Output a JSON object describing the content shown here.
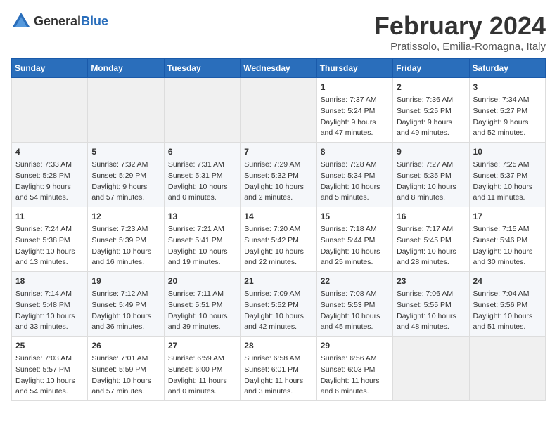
{
  "logo": {
    "text_general": "General",
    "text_blue": "Blue"
  },
  "calendar": {
    "title": "February 2024",
    "subtitle": "Pratissolo, Emilia-Romagna, Italy",
    "days_header": [
      "Sunday",
      "Monday",
      "Tuesday",
      "Wednesday",
      "Thursday",
      "Friday",
      "Saturday"
    ],
    "weeks": [
      [
        {
          "day": "",
          "content": ""
        },
        {
          "day": "",
          "content": ""
        },
        {
          "day": "",
          "content": ""
        },
        {
          "day": "",
          "content": ""
        },
        {
          "day": "1",
          "content": "Sunrise: 7:37 AM\nSunset: 5:24 PM\nDaylight: 9 hours\nand 47 minutes."
        },
        {
          "day": "2",
          "content": "Sunrise: 7:36 AM\nSunset: 5:25 PM\nDaylight: 9 hours\nand 49 minutes."
        },
        {
          "day": "3",
          "content": "Sunrise: 7:34 AM\nSunset: 5:27 PM\nDaylight: 9 hours\nand 52 minutes."
        }
      ],
      [
        {
          "day": "4",
          "content": "Sunrise: 7:33 AM\nSunset: 5:28 PM\nDaylight: 9 hours\nand 54 minutes."
        },
        {
          "day": "5",
          "content": "Sunrise: 7:32 AM\nSunset: 5:29 PM\nDaylight: 9 hours\nand 57 minutes."
        },
        {
          "day": "6",
          "content": "Sunrise: 7:31 AM\nSunset: 5:31 PM\nDaylight: 10 hours\nand 0 minutes."
        },
        {
          "day": "7",
          "content": "Sunrise: 7:29 AM\nSunset: 5:32 PM\nDaylight: 10 hours\nand 2 minutes."
        },
        {
          "day": "8",
          "content": "Sunrise: 7:28 AM\nSunset: 5:34 PM\nDaylight: 10 hours\nand 5 minutes."
        },
        {
          "day": "9",
          "content": "Sunrise: 7:27 AM\nSunset: 5:35 PM\nDaylight: 10 hours\nand 8 minutes."
        },
        {
          "day": "10",
          "content": "Sunrise: 7:25 AM\nSunset: 5:37 PM\nDaylight: 10 hours\nand 11 minutes."
        }
      ],
      [
        {
          "day": "11",
          "content": "Sunrise: 7:24 AM\nSunset: 5:38 PM\nDaylight: 10 hours\nand 13 minutes."
        },
        {
          "day": "12",
          "content": "Sunrise: 7:23 AM\nSunset: 5:39 PM\nDaylight: 10 hours\nand 16 minutes."
        },
        {
          "day": "13",
          "content": "Sunrise: 7:21 AM\nSunset: 5:41 PM\nDaylight: 10 hours\nand 19 minutes."
        },
        {
          "day": "14",
          "content": "Sunrise: 7:20 AM\nSunset: 5:42 PM\nDaylight: 10 hours\nand 22 minutes."
        },
        {
          "day": "15",
          "content": "Sunrise: 7:18 AM\nSunset: 5:44 PM\nDaylight: 10 hours\nand 25 minutes."
        },
        {
          "day": "16",
          "content": "Sunrise: 7:17 AM\nSunset: 5:45 PM\nDaylight: 10 hours\nand 28 minutes."
        },
        {
          "day": "17",
          "content": "Sunrise: 7:15 AM\nSunset: 5:46 PM\nDaylight: 10 hours\nand 30 minutes."
        }
      ],
      [
        {
          "day": "18",
          "content": "Sunrise: 7:14 AM\nSunset: 5:48 PM\nDaylight: 10 hours\nand 33 minutes."
        },
        {
          "day": "19",
          "content": "Sunrise: 7:12 AM\nSunset: 5:49 PM\nDaylight: 10 hours\nand 36 minutes."
        },
        {
          "day": "20",
          "content": "Sunrise: 7:11 AM\nSunset: 5:51 PM\nDaylight: 10 hours\nand 39 minutes."
        },
        {
          "day": "21",
          "content": "Sunrise: 7:09 AM\nSunset: 5:52 PM\nDaylight: 10 hours\nand 42 minutes."
        },
        {
          "day": "22",
          "content": "Sunrise: 7:08 AM\nSunset: 5:53 PM\nDaylight: 10 hours\nand 45 minutes."
        },
        {
          "day": "23",
          "content": "Sunrise: 7:06 AM\nSunset: 5:55 PM\nDaylight: 10 hours\nand 48 minutes."
        },
        {
          "day": "24",
          "content": "Sunrise: 7:04 AM\nSunset: 5:56 PM\nDaylight: 10 hours\nand 51 minutes."
        }
      ],
      [
        {
          "day": "25",
          "content": "Sunrise: 7:03 AM\nSunset: 5:57 PM\nDaylight: 10 hours\nand 54 minutes."
        },
        {
          "day": "26",
          "content": "Sunrise: 7:01 AM\nSunset: 5:59 PM\nDaylight: 10 hours\nand 57 minutes."
        },
        {
          "day": "27",
          "content": "Sunrise: 6:59 AM\nSunset: 6:00 PM\nDaylight: 11 hours\nand 0 minutes."
        },
        {
          "day": "28",
          "content": "Sunrise: 6:58 AM\nSunset: 6:01 PM\nDaylight: 11 hours\nand 3 minutes."
        },
        {
          "day": "29",
          "content": "Sunrise: 6:56 AM\nSunset: 6:03 PM\nDaylight: 11 hours\nand 6 minutes."
        },
        {
          "day": "",
          "content": ""
        },
        {
          "day": "",
          "content": ""
        }
      ]
    ]
  }
}
